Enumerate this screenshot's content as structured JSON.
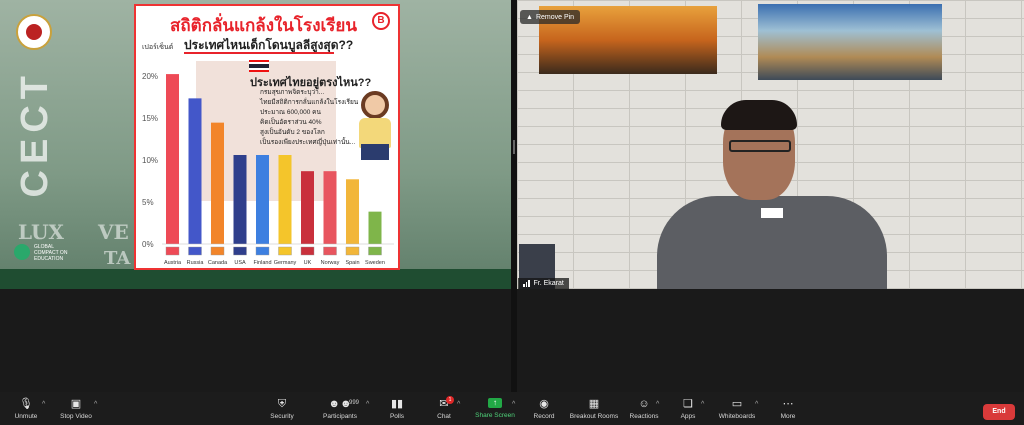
{
  "slide": {
    "title": "สถิติกลั่นแกล้งในโรงเรียน",
    "subtitle": "ประเทศไหนเด็กโดนบูลลีสูงสุด??",
    "badge": "B",
    "side_text_top": "CECT",
    "side_text_left": "LUX",
    "side_text_mid": "VE",
    "side_text_bottom": "TA",
    "gce_logo_text": "GLOBAL COMPACT ON EDUCATION",
    "callout_title": "ประเทศไทยอยู่ตรงไหน??",
    "callout_lines": [
      "กรมสุขภาพจิตระบุว่า...",
      "ไทยมีสถิติการกลั่นแกล้งในโรงเรียน",
      "ประมาณ 600,000 คน",
      "คิดเป็นอัตราส่วน 40%",
      "สูงเป็นอันดับ 2 ของโลก",
      "เป็นรองเพียงประเทศญี่ปุ่นเท่านั้น..."
    ]
  },
  "chart_data": {
    "type": "bar",
    "title": "สถิติกลั่นแกล้งในโรงเรียน",
    "ylabel": "เปอร์เซ็นต์",
    "categories": [
      "Austria",
      "Russia",
      "Canada",
      "USA",
      "Finland",
      "Germany",
      "UK",
      "Norway",
      "Spain",
      "Sweden"
    ],
    "values": [
      21,
      18,
      15,
      11,
      11,
      11,
      9,
      9,
      8,
      4
    ],
    "yticks": [
      "20%",
      "15%",
      "10%",
      "5%",
      "0%"
    ],
    "ylim": [
      0,
      22
    ],
    "colors": [
      "#ee4a56",
      "#4357c9",
      "#f2852a",
      "#2f3f8c",
      "#3d7fe0",
      "#f4c52b",
      "#c9303c",
      "#e8555f",
      "#f2b63a",
      "#7fb54a"
    ],
    "grid": false,
    "legend": "none"
  },
  "video": {
    "pin_label": "Remove Pin",
    "participant_name": "Fr. Ekarat"
  },
  "toolbar": {
    "unmute": "Unmute",
    "stop_video": "Stop Video",
    "security": "Security",
    "participants": "Participants",
    "participants_count": "999",
    "polls": "Polls",
    "chat": "Chat",
    "chat_badge": "1",
    "share_screen": "Share Screen",
    "record": "Record",
    "breakout_rooms": "Breakout Rooms",
    "reactions": "Reactions",
    "apps": "Apps",
    "whiteboards": "Whiteboards",
    "more": "More",
    "end": "End"
  }
}
